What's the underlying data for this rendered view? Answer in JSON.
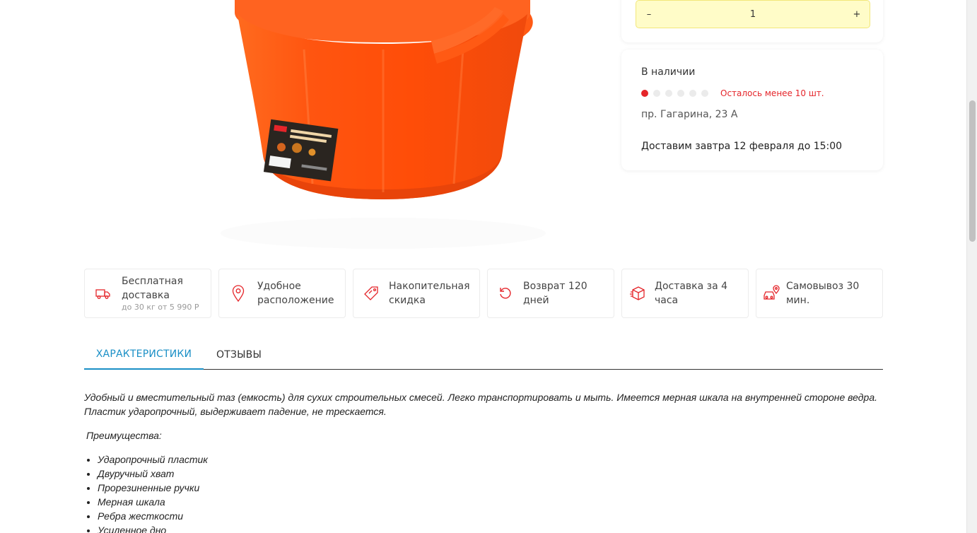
{
  "quantity": {
    "minus": "–",
    "value": "1",
    "plus": "+"
  },
  "stock": {
    "title": "В наличии",
    "level_filled": 1,
    "level_total": 6,
    "note": "Осталось менее 10 шт.",
    "address": "пр. Гагарина, 23 А",
    "delivery": "Доставим завтра 12 февраля до 15:00"
  },
  "features": [
    {
      "icon": "truck-icon",
      "label": "Бесплатная доставка",
      "sub": "до 30 кг от 5 990 Р"
    },
    {
      "icon": "map-pin-icon",
      "label": "Удобное расположение"
    },
    {
      "icon": "discount-tag-icon",
      "label": "Накопительная скидка"
    },
    {
      "icon": "return-arrow-icon",
      "label": "Возврат 120 дней"
    },
    {
      "icon": "box-icon",
      "label": "Доставка за 4 часа"
    },
    {
      "icon": "car-pin-icon",
      "label": "Самовывоз 30 мин."
    }
  ],
  "tabs": [
    {
      "label": "ХАРАКТЕРИСТИКИ",
      "active": true
    },
    {
      "label": "ОТЗЫВЫ",
      "active": false
    }
  ],
  "description": {
    "lead": "Удобный и вместительный таз (емкость) для сухих строительных смесей. Легко транспортировать и мыть. Имеется мерная шкала на внутренней стороне ведра. Пластик ударопрочный, выдерживает падение, не трескается.",
    "advantages_title": "Преимущества:",
    "advantages": [
      "Ударопрочный пластик",
      "Двуручный хват",
      "Прорезиненные ручки",
      "Мерная шкала",
      "Ребра жесткости",
      "Усиленное дно"
    ]
  },
  "colors": {
    "accent_red": "#e5252a",
    "accent_blue": "#1a8fc6",
    "qty_bg": "#fffcc8",
    "bucket_orange": "#ff5a14"
  }
}
